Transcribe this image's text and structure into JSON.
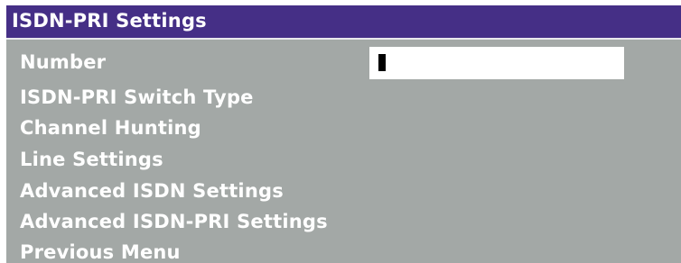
{
  "window": {
    "title": "ISDN-PRI Settings"
  },
  "menu": {
    "items": [
      {
        "label": "Number"
      },
      {
        "label": "ISDN-PRI Switch Type"
      },
      {
        "label": "Channel Hunting"
      },
      {
        "label": "Line Settings"
      },
      {
        "label": "Advanced ISDN Settings"
      },
      {
        "label": "Advanced ISDN-PRI Settings"
      },
      {
        "label": "Previous Menu"
      }
    ]
  },
  "number_field": {
    "value": ""
  },
  "colors": {
    "title_bar": "#452f86",
    "panel_background": "#a3a8a6",
    "text": "#ffffff",
    "field_background": "#ffffff",
    "cursor": "#000000"
  },
  "icons": {
    "text_cursor": "text-cursor-icon"
  }
}
